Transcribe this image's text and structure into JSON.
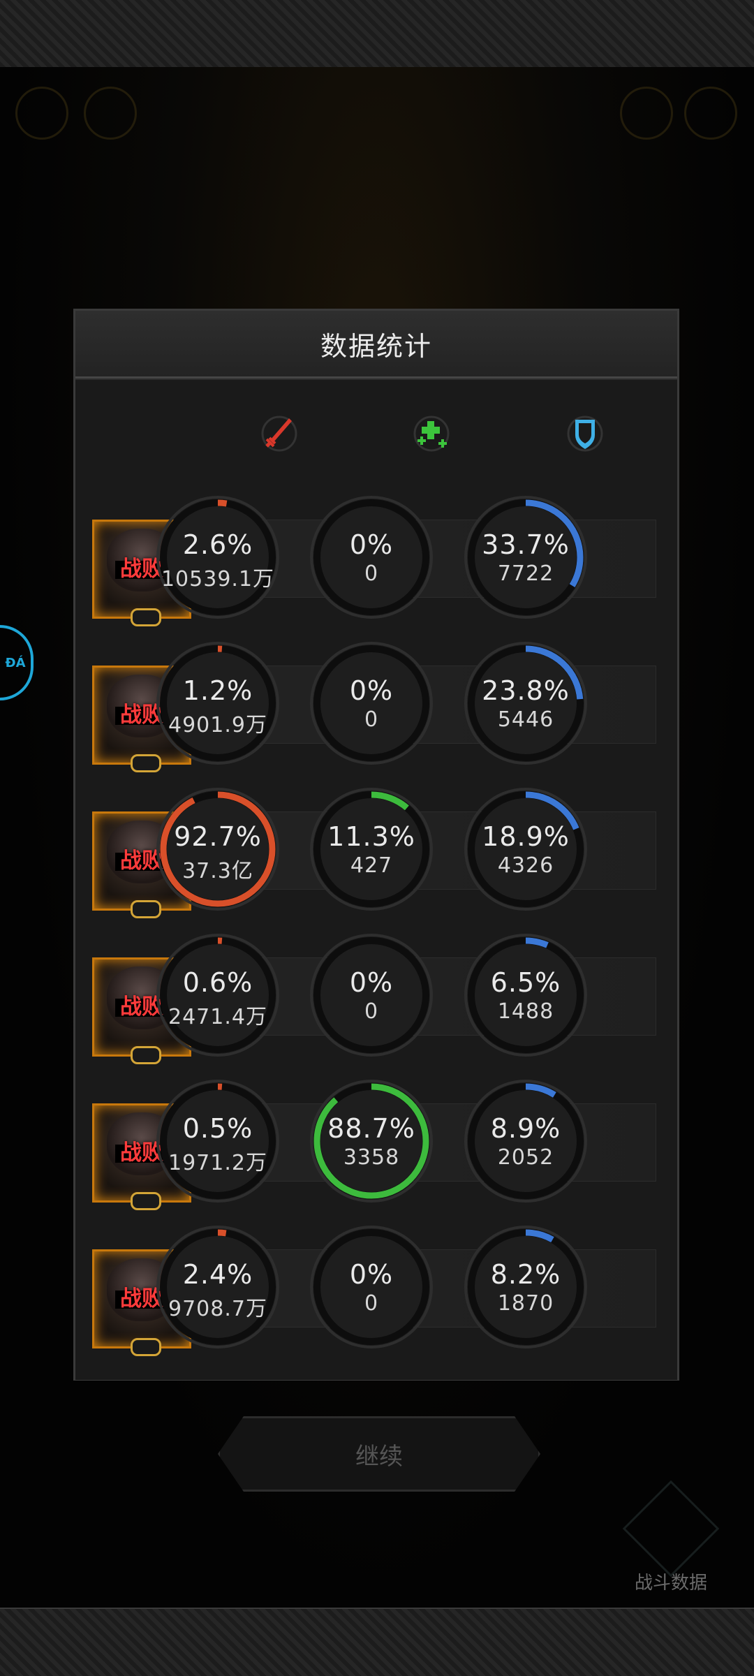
{
  "dialog": {
    "title": "数据统计"
  },
  "columns": [
    {
      "icon": "sword-icon",
      "color": "#d9382b"
    },
    {
      "icon": "heal-plus-icon",
      "color": "#3cc43c"
    },
    {
      "icon": "shield-icon",
      "color": "#3fb0e6"
    }
  ],
  "colors": {
    "damage": "#d9502a",
    "heal": "#3dbb3d",
    "tank": "#3b78d6",
    "portrait_border": "#c8780c",
    "defeat_text": "#ff3b3b"
  },
  "rows": [
    {
      "status": "战败",
      "damage": {
        "pct": "2.6%",
        "value": "10539.1万",
        "fraction": 0.026
      },
      "heal": {
        "pct": "0%",
        "value": "0",
        "fraction": 0
      },
      "tank": {
        "pct": "33.7%",
        "value": "7722",
        "fraction": 0.337
      }
    },
    {
      "status": "战败",
      "damage": {
        "pct": "1.2%",
        "value": "4901.9万",
        "fraction": 0.012
      },
      "heal": {
        "pct": "0%",
        "value": "0",
        "fraction": 0
      },
      "tank": {
        "pct": "23.8%",
        "value": "5446",
        "fraction": 0.238
      }
    },
    {
      "status": "战败",
      "damage": {
        "pct": "92.7%",
        "value": "37.3亿",
        "fraction": 0.927
      },
      "heal": {
        "pct": "11.3%",
        "value": "427",
        "fraction": 0.113
      },
      "tank": {
        "pct": "18.9%",
        "value": "4326",
        "fraction": 0.189
      }
    },
    {
      "status": "战败",
      "damage": {
        "pct": "0.6%",
        "value": "2471.4万",
        "fraction": 0.006
      },
      "heal": {
        "pct": "0%",
        "value": "0",
        "fraction": 0
      },
      "tank": {
        "pct": "6.5%",
        "value": "1488",
        "fraction": 0.065
      }
    },
    {
      "status": "战败",
      "damage": {
        "pct": "0.5%",
        "value": "1971.2万",
        "fraction": 0.005
      },
      "heal": {
        "pct": "88.7%",
        "value": "3358",
        "fraction": 0.887
      },
      "tank": {
        "pct": "8.9%",
        "value": "2052",
        "fraction": 0.089
      }
    },
    {
      "status": "战败",
      "damage": {
        "pct": "2.4%",
        "value": "9708.7万",
        "fraction": 0.024
      },
      "heal": {
        "pct": "0%",
        "value": "0",
        "fraction": 0
      },
      "tank": {
        "pct": "8.2%",
        "value": "1870",
        "fraction": 0.082
      }
    }
  ],
  "continue_label": "继续",
  "battle_stats_label": "战斗数据"
}
